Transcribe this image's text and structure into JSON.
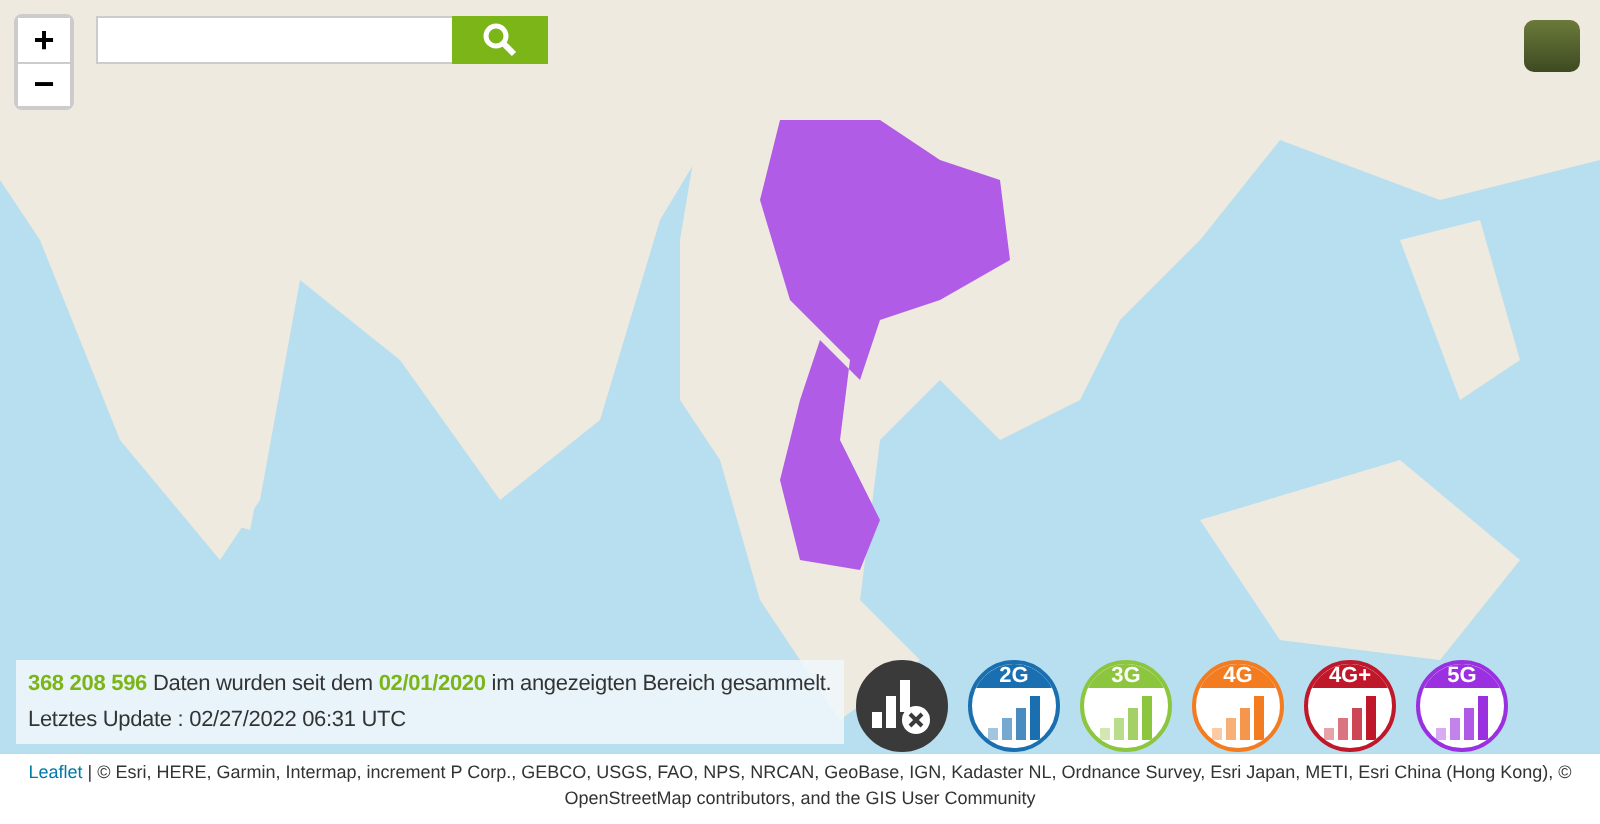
{
  "zoom_controls": {
    "zoom_in": "+",
    "zoom_out": "−"
  },
  "info": {
    "count": "368 208 596",
    "text_before_date": "Daten wurden seit dem",
    "date": "02/01/2020",
    "text_after_date": "im angezeigten Bereich gesammelt.",
    "update": "Letztes Update : 02/27/2022 06:31 UTC"
  },
  "network_filters": [
    {
      "kind": "no-signal",
      "selected": true
    },
    {
      "kind": "network",
      "label": "2G",
      "color": "#1a6fb0",
      "selected": true
    },
    {
      "kind": "network",
      "label": "3G",
      "color": "#8cc63f",
      "selected": true
    },
    {
      "kind": "network",
      "label": "4G",
      "color": "#f47c20",
      "selected": true
    },
    {
      "kind": "network",
      "label": "4G+",
      "color": "#c0182b",
      "selected": true
    },
    {
      "kind": "network",
      "label": "5G",
      "color": "#9b30e0",
      "selected": true
    }
  ],
  "attribution": {
    "link": "Leaflet",
    "text": "| © Esri, HERE, Garmin, Intermap, increment P Corp., GEBCO, USGS, FAO, NPS, NRCAN, GeoBase, IGN, Kadaster NL, Ordnance Survey, Esri Japan, METI, Esri China (Hong Kong), © OpenStreetMap contributors, and the GIS User Community"
  }
}
